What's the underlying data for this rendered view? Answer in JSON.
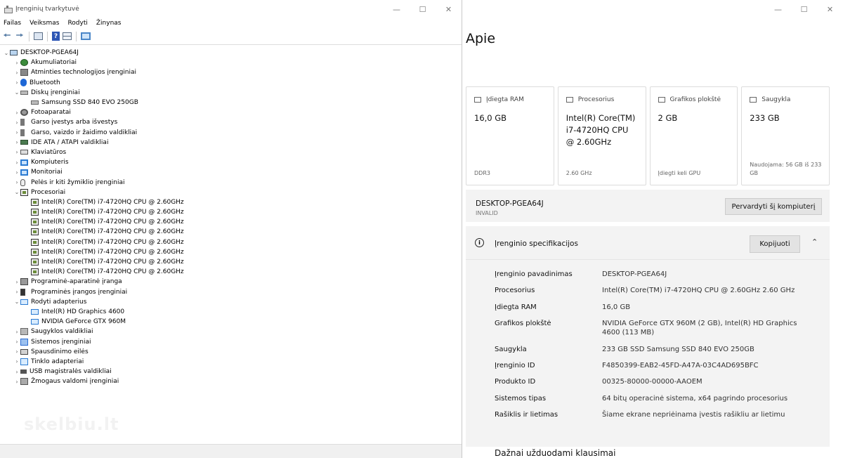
{
  "device_manager": {
    "title": "Įrenginių tvarkytuvė",
    "menu": [
      "Failas",
      "Veiksmas",
      "Rodyti",
      "Žinynas"
    ],
    "tree": [
      {
        "label": "DESKTOP-PGEA64J",
        "level": 0,
        "toggle": "⌄",
        "icon": "computer-icon"
      },
      {
        "label": "Akumuliatoriai",
        "level": 1,
        "toggle": "›",
        "icon": "battery-icon"
      },
      {
        "label": "Atminties technologijos įrenginiai",
        "level": 1,
        "toggle": "›",
        "icon": "memory-device-icon"
      },
      {
        "label": "Bluetooth",
        "level": 1,
        "toggle": "›",
        "icon": "bluetooth-icon"
      },
      {
        "label": "Diskų įrenginiai",
        "level": 1,
        "toggle": "⌄",
        "icon": "disk-icon"
      },
      {
        "label": "Samsung SSD 840 EVO 250GB",
        "level": 2,
        "toggle": "",
        "icon": "disk-icon"
      },
      {
        "label": "Fotoaparatai",
        "level": 1,
        "toggle": "›",
        "icon": "camera-icon"
      },
      {
        "label": "Garso įvestys arba išvestys",
        "level": 1,
        "toggle": "›",
        "icon": "speaker-icon"
      },
      {
        "label": "Garso, vaizdo ir žaidimo valdikliai",
        "level": 1,
        "toggle": "›",
        "icon": "speaker-icon"
      },
      {
        "label": "IDE ATA / ATAPI valdikliai",
        "level": 1,
        "toggle": "›",
        "icon": "ide-controller-icon"
      },
      {
        "label": "Klaviatūros",
        "level": 1,
        "toggle": "›",
        "icon": "keyboard-icon"
      },
      {
        "label": "Kompiuteris",
        "level": 1,
        "toggle": "›",
        "icon": "monitor-icon"
      },
      {
        "label": "Monitoriai",
        "level": 1,
        "toggle": "›",
        "icon": "monitor-icon"
      },
      {
        "label": "Pelės ir kiti žymiklio įrenginiai",
        "level": 1,
        "toggle": "›",
        "icon": "mouse-icon"
      },
      {
        "label": "Procesoriai",
        "level": 1,
        "toggle": "⌄",
        "icon": "cpu-icon"
      },
      {
        "label": "Intel(R) Core(TM) i7-4720HQ CPU @ 2.60GHz",
        "level": 2,
        "toggle": "",
        "icon": "cpu-icon"
      },
      {
        "label": "Intel(R) Core(TM) i7-4720HQ CPU @ 2.60GHz",
        "level": 2,
        "toggle": "",
        "icon": "cpu-icon"
      },
      {
        "label": "Intel(R) Core(TM) i7-4720HQ CPU @ 2.60GHz",
        "level": 2,
        "toggle": "",
        "icon": "cpu-icon"
      },
      {
        "label": "Intel(R) Core(TM) i7-4720HQ CPU @ 2.60GHz",
        "level": 2,
        "toggle": "",
        "icon": "cpu-icon"
      },
      {
        "label": "Intel(R) Core(TM) i7-4720HQ CPU @ 2.60GHz",
        "level": 2,
        "toggle": "",
        "icon": "cpu-icon"
      },
      {
        "label": "Intel(R) Core(TM) i7-4720HQ CPU @ 2.60GHz",
        "level": 2,
        "toggle": "",
        "icon": "cpu-icon"
      },
      {
        "label": "Intel(R) Core(TM) i7-4720HQ CPU @ 2.60GHz",
        "level": 2,
        "toggle": "",
        "icon": "cpu-icon"
      },
      {
        "label": "Intel(R) Core(TM) i7-4720HQ CPU @ 2.60GHz",
        "level": 2,
        "toggle": "",
        "icon": "cpu-icon"
      },
      {
        "label": "Programinė-aparatinė įranga",
        "level": 1,
        "toggle": "›",
        "icon": "firmware-icon"
      },
      {
        "label": "Programinės įrangos įrenginiai",
        "level": 1,
        "toggle": "›",
        "icon": "software-device-icon"
      },
      {
        "label": "Rodyti adapterius",
        "level": 1,
        "toggle": "⌄",
        "icon": "display-adapter-icon"
      },
      {
        "label": "Intel(R) HD Graphics 4600",
        "level": 2,
        "toggle": "",
        "icon": "display-adapter-icon"
      },
      {
        "label": "NVIDIA GeForce GTX 960M",
        "level": 2,
        "toggle": "",
        "icon": "display-adapter-icon"
      },
      {
        "label": "Saugyklos valdikliai",
        "level": 1,
        "toggle": "›",
        "icon": "storage-controller-icon"
      },
      {
        "label": "Sistemos įrenginiai",
        "level": 1,
        "toggle": "›",
        "icon": "system-device-icon"
      },
      {
        "label": "Spausdinimo eilės",
        "level": 1,
        "toggle": "›",
        "icon": "printer-icon"
      },
      {
        "label": "Tinklo adapteriai",
        "level": 1,
        "toggle": "›",
        "icon": "network-adapter-icon"
      },
      {
        "label": "USB magistralės valdikliai",
        "level": 1,
        "toggle": "›",
        "icon": "usb-icon"
      },
      {
        "label": "Žmogaus valdomi įrenginiai",
        "level": 1,
        "toggle": "›",
        "icon": "human-interface-icon"
      }
    ],
    "watermark": "skelbiu.lt"
  },
  "about": {
    "heading": "Apie",
    "cards": [
      {
        "label": "Įdiegta RAM",
        "value": "16,0 GB",
        "foot": "DDR3",
        "icon": "ram-icon"
      },
      {
        "label": "Procesorius",
        "value": "Intel(R) Core(TM) i7-4720HQ CPU @ 2.60GHz",
        "foot": "2.60 GHz",
        "icon": "processor-icon"
      },
      {
        "label": "Grafikos plokštė",
        "value": "2 GB",
        "foot": "Įdiegti keli GPU",
        "icon": "gpu-icon"
      },
      {
        "label": "Saugykla",
        "value": "233 GB",
        "foot": "Naudojama: 56 GB iš 233 GB",
        "icon": "storage-icon"
      }
    ],
    "device_name": "DESKTOP-PGEA64J",
    "device_sub": "INVALID",
    "rename_label": "Pervardyti šį kompiuterį",
    "spec_title": "Įrenginio specifikacijos",
    "copy_label": "Kopijuoti",
    "specs": [
      {
        "k": "Įrenginio pavadinimas",
        "v": "DESKTOP-PGEA64J"
      },
      {
        "k": "Procesorius",
        "v": "Intel(R) Core(TM) i7-4720HQ CPU @ 2.60GHz   2.60 GHz"
      },
      {
        "k": "Įdiegta RAM",
        "v": "16,0 GB"
      },
      {
        "k": "Grafikos plokštė",
        "v": "NVIDIA GeForce GTX 960M (2 GB), Intel(R) HD Graphics 4600 (113 MB)"
      },
      {
        "k": "Saugykla",
        "v": "233 GB SSD Samsung SSD 840 EVO 250GB"
      },
      {
        "k": "Įrenginio ID",
        "v": "F4850399-EAB2-45FD-A47A-03C4AD695BFC"
      },
      {
        "k": "Produkto ID",
        "v": "00325-80000-00000-AAOEM"
      },
      {
        "k": "Sistemos tipas",
        "v": "64 bitų operacinė sistema, x64 pagrindo procesorius"
      },
      {
        "k": "Rašiklis ir lietimas",
        "v": "Šiame ekrane nepriėinama įvestis rašikliu ar lietimu"
      }
    ],
    "faq_title": "Dažnai užduodami klausimai"
  }
}
